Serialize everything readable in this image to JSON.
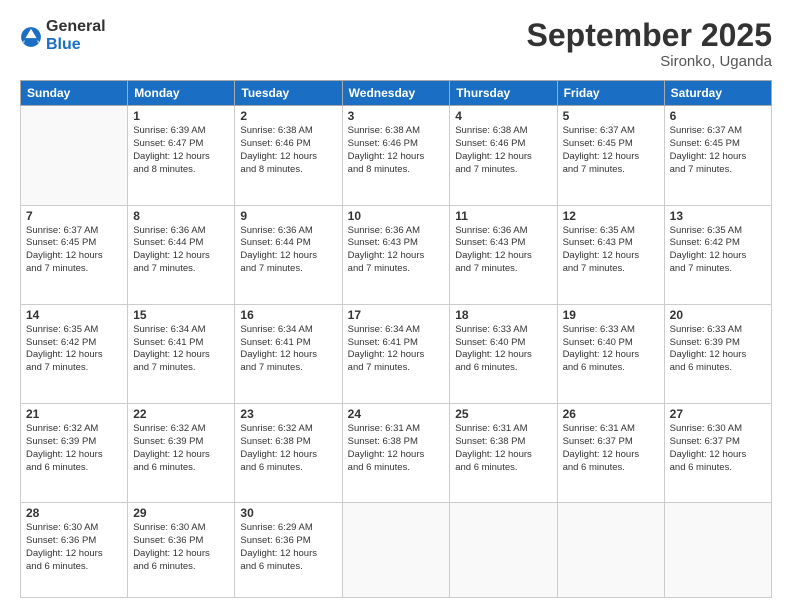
{
  "header": {
    "logo": {
      "general": "General",
      "blue": "Blue"
    },
    "title": "September 2025",
    "location": "Sironko, Uganda"
  },
  "weekdays": [
    "Sunday",
    "Monday",
    "Tuesday",
    "Wednesday",
    "Thursday",
    "Friday",
    "Saturday"
  ],
  "weeks": [
    [
      {
        "day": "",
        "info": ""
      },
      {
        "day": "1",
        "info": "Sunrise: 6:39 AM\nSunset: 6:47 PM\nDaylight: 12 hours\nand 8 minutes."
      },
      {
        "day": "2",
        "info": "Sunrise: 6:38 AM\nSunset: 6:46 PM\nDaylight: 12 hours\nand 8 minutes."
      },
      {
        "day": "3",
        "info": "Sunrise: 6:38 AM\nSunset: 6:46 PM\nDaylight: 12 hours\nand 8 minutes."
      },
      {
        "day": "4",
        "info": "Sunrise: 6:38 AM\nSunset: 6:46 PM\nDaylight: 12 hours\nand 7 minutes."
      },
      {
        "day": "5",
        "info": "Sunrise: 6:37 AM\nSunset: 6:45 PM\nDaylight: 12 hours\nand 7 minutes."
      },
      {
        "day": "6",
        "info": "Sunrise: 6:37 AM\nSunset: 6:45 PM\nDaylight: 12 hours\nand 7 minutes."
      }
    ],
    [
      {
        "day": "7",
        "info": "Sunrise: 6:37 AM\nSunset: 6:45 PM\nDaylight: 12 hours\nand 7 minutes."
      },
      {
        "day": "8",
        "info": "Sunrise: 6:36 AM\nSunset: 6:44 PM\nDaylight: 12 hours\nand 7 minutes."
      },
      {
        "day": "9",
        "info": "Sunrise: 6:36 AM\nSunset: 6:44 PM\nDaylight: 12 hours\nand 7 minutes."
      },
      {
        "day": "10",
        "info": "Sunrise: 6:36 AM\nSunset: 6:43 PM\nDaylight: 12 hours\nand 7 minutes."
      },
      {
        "day": "11",
        "info": "Sunrise: 6:36 AM\nSunset: 6:43 PM\nDaylight: 12 hours\nand 7 minutes."
      },
      {
        "day": "12",
        "info": "Sunrise: 6:35 AM\nSunset: 6:43 PM\nDaylight: 12 hours\nand 7 minutes."
      },
      {
        "day": "13",
        "info": "Sunrise: 6:35 AM\nSunset: 6:42 PM\nDaylight: 12 hours\nand 7 minutes."
      }
    ],
    [
      {
        "day": "14",
        "info": "Sunrise: 6:35 AM\nSunset: 6:42 PM\nDaylight: 12 hours\nand 7 minutes."
      },
      {
        "day": "15",
        "info": "Sunrise: 6:34 AM\nSunset: 6:41 PM\nDaylight: 12 hours\nand 7 minutes."
      },
      {
        "day": "16",
        "info": "Sunrise: 6:34 AM\nSunset: 6:41 PM\nDaylight: 12 hours\nand 7 minutes."
      },
      {
        "day": "17",
        "info": "Sunrise: 6:34 AM\nSunset: 6:41 PM\nDaylight: 12 hours\nand 7 minutes."
      },
      {
        "day": "18",
        "info": "Sunrise: 6:33 AM\nSunset: 6:40 PM\nDaylight: 12 hours\nand 6 minutes."
      },
      {
        "day": "19",
        "info": "Sunrise: 6:33 AM\nSunset: 6:40 PM\nDaylight: 12 hours\nand 6 minutes."
      },
      {
        "day": "20",
        "info": "Sunrise: 6:33 AM\nSunset: 6:39 PM\nDaylight: 12 hours\nand 6 minutes."
      }
    ],
    [
      {
        "day": "21",
        "info": "Sunrise: 6:32 AM\nSunset: 6:39 PM\nDaylight: 12 hours\nand 6 minutes."
      },
      {
        "day": "22",
        "info": "Sunrise: 6:32 AM\nSunset: 6:39 PM\nDaylight: 12 hours\nand 6 minutes."
      },
      {
        "day": "23",
        "info": "Sunrise: 6:32 AM\nSunset: 6:38 PM\nDaylight: 12 hours\nand 6 minutes."
      },
      {
        "day": "24",
        "info": "Sunrise: 6:31 AM\nSunset: 6:38 PM\nDaylight: 12 hours\nand 6 minutes."
      },
      {
        "day": "25",
        "info": "Sunrise: 6:31 AM\nSunset: 6:38 PM\nDaylight: 12 hours\nand 6 minutes."
      },
      {
        "day": "26",
        "info": "Sunrise: 6:31 AM\nSunset: 6:37 PM\nDaylight: 12 hours\nand 6 minutes."
      },
      {
        "day": "27",
        "info": "Sunrise: 6:30 AM\nSunset: 6:37 PM\nDaylight: 12 hours\nand 6 minutes."
      }
    ],
    [
      {
        "day": "28",
        "info": "Sunrise: 6:30 AM\nSunset: 6:36 PM\nDaylight: 12 hours\nand 6 minutes."
      },
      {
        "day": "29",
        "info": "Sunrise: 6:30 AM\nSunset: 6:36 PM\nDaylight: 12 hours\nand 6 minutes."
      },
      {
        "day": "30",
        "info": "Sunrise: 6:29 AM\nSunset: 6:36 PM\nDaylight: 12 hours\nand 6 minutes."
      },
      {
        "day": "",
        "info": ""
      },
      {
        "day": "",
        "info": ""
      },
      {
        "day": "",
        "info": ""
      },
      {
        "day": "",
        "info": ""
      }
    ]
  ]
}
